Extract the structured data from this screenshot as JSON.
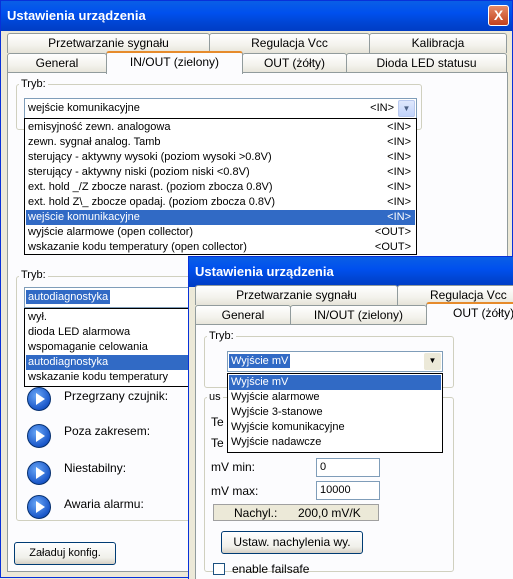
{
  "window1": {
    "title": "Ustawienia urządzenia",
    "close": "X",
    "tabs_row1": [
      "Przetwarzanie sygnału",
      "Regulacja Vcc",
      "Kalibracja"
    ],
    "tabs_row2": [
      "General",
      "IN/OUT (zielony)",
      "OUT (żółty)",
      "Dioda LED statusu"
    ],
    "mode_label": "Tryb:",
    "mode_combo_value": "wejście komunikacyjne",
    "mode_combo_suffix": "<IN>",
    "mode_list": [
      {
        "label": "emisyjność zewn. analogowa",
        "tag": "<IN>"
      },
      {
        "label": "zewn. sygnał analog. Tamb",
        "tag": "<IN>"
      },
      {
        "label": "sterujący - aktywny wysoki   (poziom wysoki >0.8V)",
        "tag": "<IN>"
      },
      {
        "label": "sterujący - aktywny niski   (poziom niski  <0.8V)",
        "tag": "<IN>"
      },
      {
        "label": "ext. hold  _/Z zbocze narast.   (poziom zbocza 0.8V)",
        "tag": "<IN>"
      },
      {
        "label": "ext. hold  Z\\_ zbocze opadaj.  (poziom zbocza 0.8V)",
        "tag": "<IN>"
      },
      {
        "label": "wejście komunikacyjne",
        "tag": "<IN>"
      },
      {
        "label": "wyjście alarmowe (open collector)",
        "tag": "<OUT>"
      },
      {
        "label": "wskazanie kodu temperatury (open collector)",
        "tag": "<OUT>"
      }
    ],
    "mode_list_selected": 6,
    "mode2_label": "Tryb:",
    "mode2_combo_value": "autodiagnostyka",
    "mode2_list": [
      "wył.",
      "dioda LED alarmowa",
      "wspomaganie celowania",
      "autodiagnostyka",
      "wskazanie kodu temperatury"
    ],
    "mode2_list_selected": 3,
    "diag_items": [
      "Przegrzany czujnik:",
      "Poza zakresem:",
      "Niestabilny:",
      "Awaria alarmu:"
    ],
    "load_button": "Załaduj konfig."
  },
  "window2": {
    "title": "Ustawienia urządzenia",
    "tabs_row1": [
      "Przetwarzanie sygnału",
      "Regulacja Vcc"
    ],
    "tabs_row2": [
      "General",
      "IN/OUT (zielony)",
      "OUT (żółty)"
    ],
    "mode_label": "Tryb:",
    "mode_combo_value": "Wyjście mV",
    "mode_list": [
      "Wyjście mV",
      "Wyjście alarmowe",
      "Wyjście 3-stanowe",
      "Wyjście komunikacyjne",
      "Wyjście nadawcze"
    ],
    "mode_list_selected": 0,
    "group2_label_partial": "us",
    "te_labels": [
      "Te",
      "Te"
    ],
    "mv_min_label": "mV min:",
    "mv_min_value": "0",
    "mv_max_label": "mV max:",
    "mv_max_value": "10000",
    "slope_label": "Nachyl.:",
    "slope_value": "200,0 mV/K",
    "slope_button": "Ustaw. nachylenia wy.",
    "failsafe_label": "enable failsafe"
  },
  "colors": {
    "titlebar": "#0054e3",
    "selection": "#316ac5",
    "tab_active_accent": "#e68b2c",
    "background": "#ece9d8"
  }
}
